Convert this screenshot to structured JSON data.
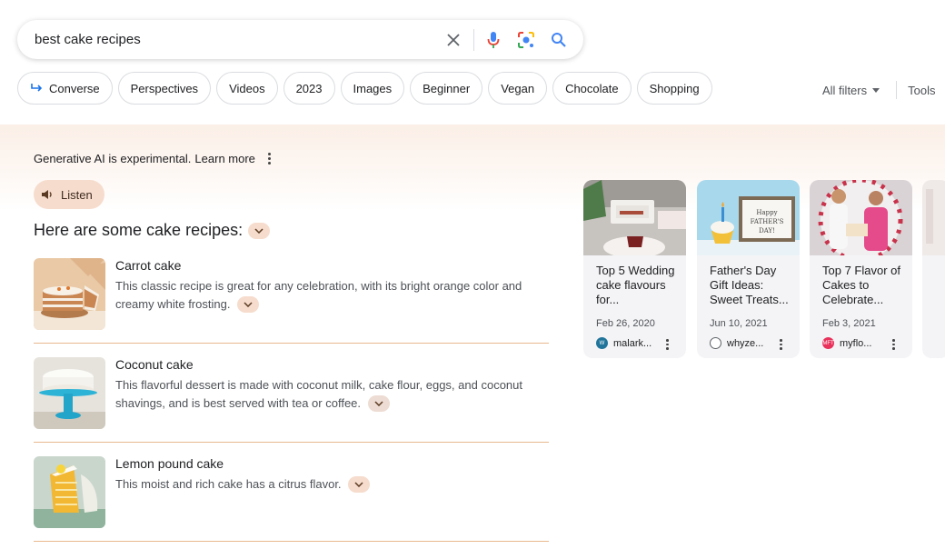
{
  "search": {
    "query": "best cake recipes",
    "icons": [
      "close-icon",
      "mic-icon",
      "lens-icon",
      "search-icon"
    ]
  },
  "chips": [
    {
      "label": "Converse",
      "icon": "converse-arrow-icon"
    },
    {
      "label": "Perspectives"
    },
    {
      "label": "Videos"
    },
    {
      "label": "2023"
    },
    {
      "label": "Images"
    },
    {
      "label": "Beginner"
    },
    {
      "label": "Vegan"
    },
    {
      "label": "Chocolate"
    },
    {
      "label": "Shopping"
    }
  ],
  "filters": {
    "all_filters": "All filters",
    "tools": "Tools"
  },
  "ai": {
    "experimental_bold": "Generative AI is experimental.",
    "learn_more": "Learn more",
    "listen": "Listen",
    "heading": "Here are some cake recipes:",
    "recipes": [
      {
        "title": "Carrot cake",
        "desc": "This classic recipe is great for any celebration, with its bright orange color and creamy white frosting."
      },
      {
        "title": "Coconut cake",
        "desc": "This flavorful dessert is made with coconut milk, cake flour, eggs, and coconut shavings, and is best served with tea or coffee."
      },
      {
        "title": "Lemon pound cake",
        "desc": "This moist and rich cake has a citrus flavor."
      }
    ]
  },
  "cards": [
    {
      "title": "Top 5 Wedding cake flavours for...",
      "date": "Feb 26, 2020",
      "source": "malark...",
      "favicon": "wordpress-icon"
    },
    {
      "title": "Father's Day Gift Ideas: Sweet Treats...",
      "date": "Jun 10, 2021",
      "source": "whyze...",
      "favicon": "site-icon"
    },
    {
      "title": "Top 7 Flavor of Cakes to Celebrate...",
      "date": "Feb 3, 2021",
      "source": "myflo...",
      "favicon": "myflowertree-icon"
    }
  ],
  "colors": {
    "accent_peach": "#f6dccd",
    "rule": "#e8b98f",
    "google_blue": "#4285f4"
  }
}
